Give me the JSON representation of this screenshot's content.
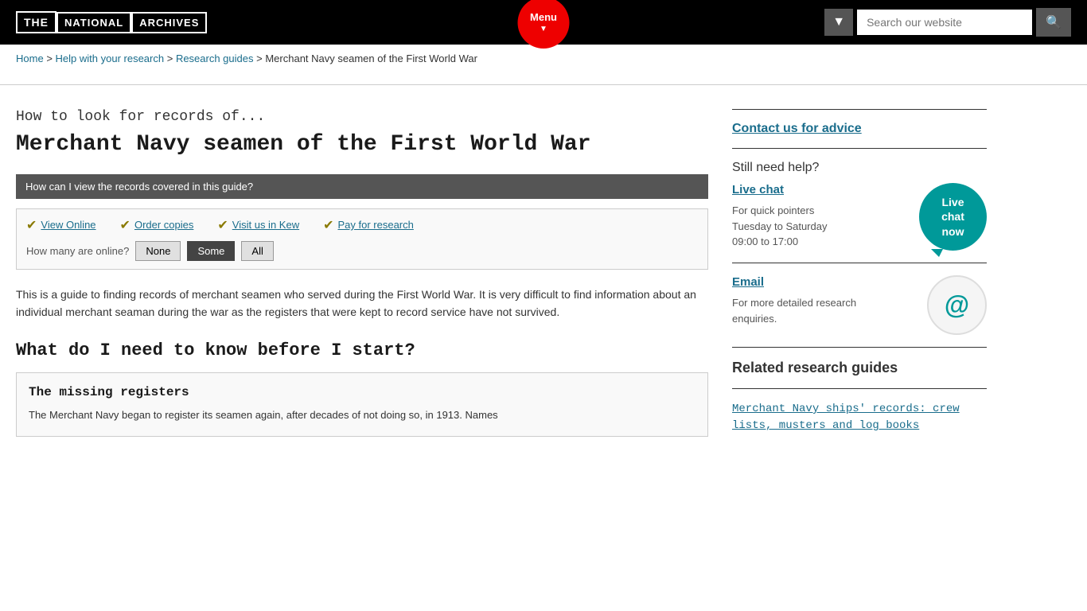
{
  "header": {
    "logo": {
      "the": "THE",
      "national": "NATIONAL",
      "archives": "ARCHIVES"
    },
    "menu_label": "Menu",
    "search_placeholder": "Search our website",
    "search_dropdown_icon": "▼"
  },
  "breadcrumb": {
    "items": [
      {
        "label": "Home",
        "href": "#"
      },
      {
        "label": "Help with your research",
        "href": "#"
      },
      {
        "label": "Research guides",
        "href": "#"
      },
      {
        "label": "Merchant Navy seamen of the First World War",
        "href": null
      }
    ],
    "separator": ">"
  },
  "content": {
    "subtitle": "How to look for records of...",
    "page_title": "Merchant Navy seamen of the First World War",
    "records_box_label": "How can I view the records covered in this guide?",
    "view_links": [
      {
        "label": "View Online"
      },
      {
        "label": "Order copies"
      },
      {
        "label": "Visit us in Kew"
      },
      {
        "label": "Pay for research"
      }
    ],
    "online_filter": {
      "label": "How many are online?",
      "options": [
        "None",
        "Some",
        "All"
      ],
      "active": "Some"
    },
    "body_text": "This is a guide to finding records of merchant seamen who served during the First World War. It is very difficult to find information about an individual merchant seaman during the war as the registers that were kept to record service have not survived.",
    "section_heading": "What do I need to know before I start?",
    "info_box": {
      "title": "The missing registers",
      "text": "The Merchant Navy began to register its seamen again, after decades of not doing so, in 1913. Names"
    }
  },
  "sidebar": {
    "contact_link": "Contact us for advice",
    "still_need_help": "Still need help?",
    "live_chat": {
      "heading": "Live chat",
      "bubble_line1": "Live",
      "bubble_line2": "chat",
      "bubble_line3": "now",
      "description_line1": "For quick pointers",
      "description_line2": "Tuesday to Saturday",
      "description_line3": "09:00 to 17:00"
    },
    "email": {
      "heading": "Email",
      "description_line1": "For more detailed research",
      "description_line2": "enquiries.",
      "icon": "@"
    },
    "related_guides": {
      "title": "Related research guides",
      "items": [
        {
          "label": "Merchant Navy ships' records: crew lists, musters and log books"
        }
      ]
    }
  }
}
